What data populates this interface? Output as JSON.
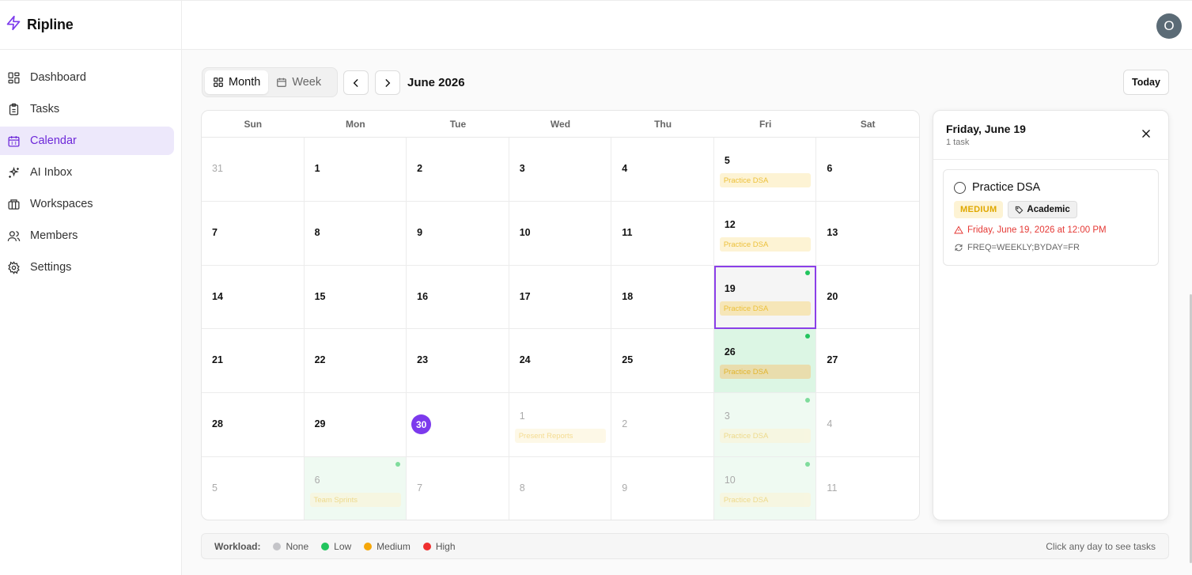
{
  "brand": {
    "name": "Ripline"
  },
  "user": {
    "avatar_initial": "O"
  },
  "sidebar": {
    "items": [
      {
        "label": "Dashboard",
        "icon": "dashboard-icon",
        "active": false
      },
      {
        "label": "Tasks",
        "icon": "clipboard-icon",
        "active": false
      },
      {
        "label": "Calendar",
        "icon": "calendar-icon",
        "active": true
      },
      {
        "label": "AI Inbox",
        "icon": "sparkles-icon",
        "active": false
      },
      {
        "label": "Workspaces",
        "icon": "workspaces-icon",
        "active": false
      },
      {
        "label": "Members",
        "icon": "members-icon",
        "active": false
      },
      {
        "label": "Settings",
        "icon": "settings-icon",
        "active": false
      }
    ]
  },
  "toolbar": {
    "month_label": "Month",
    "week_label": "Week",
    "title": "June 2026",
    "today_label": "Today"
  },
  "calendar": {
    "weekdays": [
      "Sun",
      "Mon",
      "Tue",
      "Wed",
      "Thu",
      "Fri",
      "Sat"
    ],
    "days": [
      {
        "n": "31",
        "muted": true
      },
      {
        "n": "1"
      },
      {
        "n": "2"
      },
      {
        "n": "3"
      },
      {
        "n": "4"
      },
      {
        "n": "5",
        "task": "Practice DSA"
      },
      {
        "n": "6"
      },
      {
        "n": "7"
      },
      {
        "n": "8"
      },
      {
        "n": "9"
      },
      {
        "n": "10"
      },
      {
        "n": "11"
      },
      {
        "n": "12",
        "task": "Practice DSA"
      },
      {
        "n": "13"
      },
      {
        "n": "14"
      },
      {
        "n": "15"
      },
      {
        "n": "16"
      },
      {
        "n": "17"
      },
      {
        "n": "18"
      },
      {
        "n": "19",
        "task": "Practice DSA",
        "dot": true,
        "selected": true
      },
      {
        "n": "20"
      },
      {
        "n": "21"
      },
      {
        "n": "22"
      },
      {
        "n": "23"
      },
      {
        "n": "24"
      },
      {
        "n": "25"
      },
      {
        "n": "26",
        "task": "Practice DSA",
        "dot": true,
        "bg": "green"
      },
      {
        "n": "27"
      },
      {
        "n": "28"
      },
      {
        "n": "29"
      },
      {
        "n": "30",
        "today": true
      },
      {
        "n": "1",
        "muted": true,
        "task": "Present Reports"
      },
      {
        "n": "2",
        "muted": true
      },
      {
        "n": "3",
        "muted": true,
        "task": "Practice DSA",
        "dot": true,
        "bg": "green-light"
      },
      {
        "n": "4",
        "muted": true
      },
      {
        "n": "5",
        "muted": true
      },
      {
        "n": "6",
        "muted": true,
        "task": "Team Sprints",
        "dot": true,
        "bg": "green-light"
      },
      {
        "n": "7",
        "muted": true
      },
      {
        "n": "8",
        "muted": true
      },
      {
        "n": "9",
        "muted": true
      },
      {
        "n": "10",
        "muted": true,
        "task": "Practice DSA",
        "dot": true,
        "bg": "green-light"
      },
      {
        "n": "11",
        "muted": true
      }
    ]
  },
  "legend": {
    "label": "Workload:",
    "items": [
      {
        "label": "None",
        "color": "#c4c4c8"
      },
      {
        "label": "Low",
        "color": "#22c55e"
      },
      {
        "label": "Medium",
        "color": "#f5a70a"
      },
      {
        "label": "High",
        "color": "#ef2f2f"
      }
    ],
    "hint": "Click any day to see tasks"
  },
  "detail": {
    "title": "Friday, June 19",
    "subtitle": "1 task",
    "task": {
      "name": "Practice DSA",
      "priority": "MEDIUM",
      "category": "Academic",
      "due": "Friday, June 19, 2026 at 12:00 PM",
      "recurrence": "FREQ=WEEKLY;BYDAY=FR"
    }
  },
  "colors": {
    "accent": "#7c3aed",
    "selected_outline": "#8b3fe8",
    "due": "#e53935"
  }
}
